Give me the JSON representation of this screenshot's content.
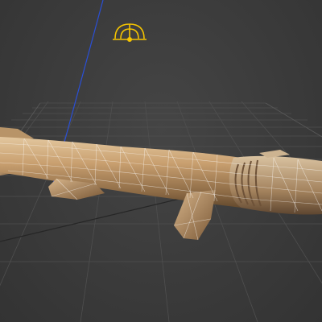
{
  "viewport": {
    "label": "",
    "background": "#3a3a3a",
    "grid_color": "#4d4d4d",
    "axis_color": "#2a4fd6",
    "camera_gizmo_color": "#f5c400"
  },
  "scene": {
    "objects": [
      {
        "name": "fish-model",
        "display": "textured-with-wireframe"
      },
      {
        "name": "camera-gizmo",
        "icon": "camera-icon"
      }
    ]
  }
}
